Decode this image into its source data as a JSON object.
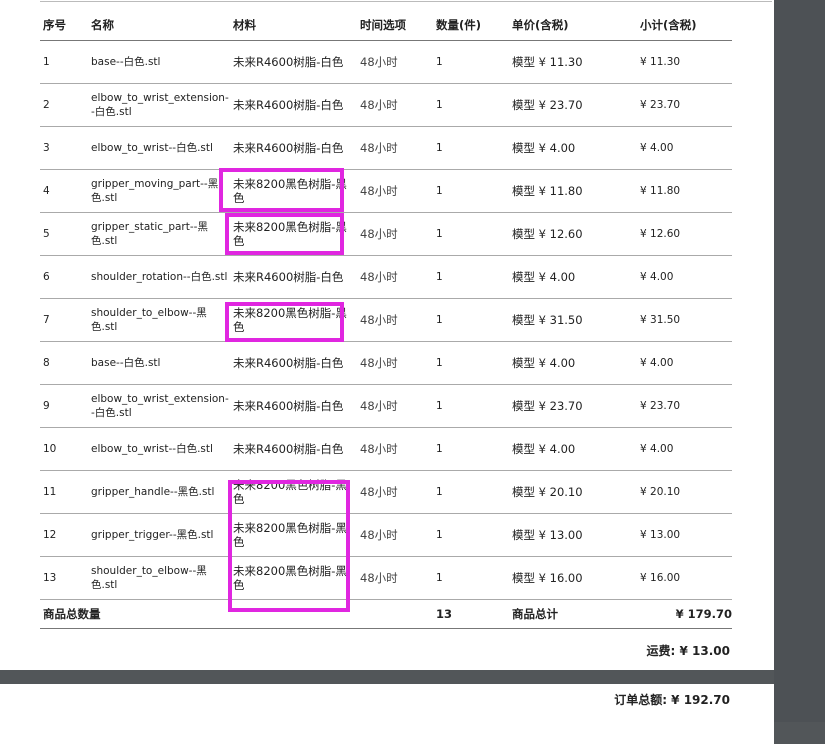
{
  "headers": {
    "no": "序号",
    "name": "名称",
    "material": "材料",
    "time": "时间选项",
    "qty": "数量(件)",
    "unit_price": "单价(含税)",
    "subtotal": "小计(含税)"
  },
  "rows": [
    {
      "no": "1",
      "name": "base--白色.stl",
      "material": "未来R4600树脂-白色",
      "time": "48小时",
      "qty": "1",
      "unit": "模型 ¥ 11.30",
      "subtotal": "¥ 11.30"
    },
    {
      "no": "2",
      "name": "elbow_to_wrist_extension--白色.stl",
      "material": "未来R4600树脂-白色",
      "time": "48小时",
      "qty": "1",
      "unit": "模型 ¥ 23.70",
      "subtotal": "¥ 23.70"
    },
    {
      "no": "3",
      "name": "elbow_to_wrist--白色.stl",
      "material": "未来R4600树脂-白色",
      "time": "48小时",
      "qty": "1",
      "unit": "模型 ¥ 4.00",
      "subtotal": "¥ 4.00"
    },
    {
      "no": "4",
      "name": "gripper_moving_part--黑色.stl",
      "material": "未来8200黑色树脂-黑色",
      "time": "48小时",
      "qty": "1",
      "unit": "模型 ¥ 11.80",
      "subtotal": "¥ 11.80"
    },
    {
      "no": "5",
      "name": "gripper_static_part--黑色.stl",
      "material": "未来8200黑色树脂-黑色",
      "time": "48小时",
      "qty": "1",
      "unit": "模型 ¥ 12.60",
      "subtotal": "¥ 12.60"
    },
    {
      "no": "6",
      "name": "shoulder_rotation--白色.stl",
      "material": "未来R4600树脂-白色",
      "time": "48小时",
      "qty": "1",
      "unit": "模型 ¥ 4.00",
      "subtotal": "¥ 4.00"
    },
    {
      "no": "7",
      "name": "shoulder_to_elbow--黑色.stl",
      "material": "未来8200黑色树脂-黑色",
      "time": "48小时",
      "qty": "1",
      "unit": "模型 ¥ 31.50",
      "subtotal": "¥ 31.50"
    },
    {
      "no": "8",
      "name": "base--白色.stl",
      "material": "未来R4600树脂-白色",
      "time": "48小时",
      "qty": "1",
      "unit": "模型 ¥ 4.00",
      "subtotal": "¥ 4.00"
    },
    {
      "no": "9",
      "name": "elbow_to_wrist_extension--白色.stl",
      "material": "未来R4600树脂-白色",
      "time": "48小时",
      "qty": "1",
      "unit": "模型 ¥ 23.70",
      "subtotal": "¥ 23.70"
    },
    {
      "no": "10",
      "name": "elbow_to_wrist--白色.stl",
      "material": "未来R4600树脂-白色",
      "time": "48小时",
      "qty": "1",
      "unit": "模型 ¥ 4.00",
      "subtotal": "¥ 4.00"
    },
    {
      "no": "11",
      "name": "gripper_handle--黑色.stl",
      "material": "未来8200黑色树脂-黑色",
      "time": "48小时",
      "qty": "1",
      "unit": "模型 ¥ 20.10",
      "subtotal": "¥ 20.10"
    },
    {
      "no": "12",
      "name": "gripper_trigger--黑色.stl",
      "material": "未来8200黑色树脂-黑色",
      "time": "48小时",
      "qty": "1",
      "unit": "模型 ¥ 13.00",
      "subtotal": "¥ 13.00"
    },
    {
      "no": "13",
      "name": "shoulder_to_elbow--黑色.stl",
      "material": "未来8200黑色树脂-黑色",
      "time": "48小时",
      "qty": "1",
      "unit": "模型 ¥ 16.00",
      "subtotal": "¥ 16.00"
    }
  ],
  "totals": {
    "qty_label": "商品总数量",
    "qty_value": "13",
    "sum_label": "商品总计",
    "sum_value": "¥ 179.70",
    "shipping": "运费: ¥ 13.00",
    "grand_total": "订单总额: ¥ 192.70"
  },
  "highlight_color": "#e026e0"
}
